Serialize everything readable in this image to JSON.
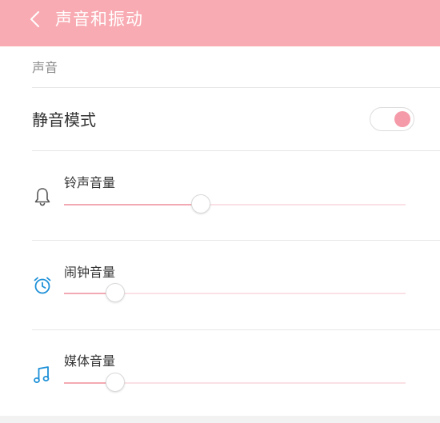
{
  "header": {
    "title": "声音和振动",
    "background": "#f8abb2",
    "back_icon": "chevron-left-icon"
  },
  "section": {
    "label": "声音"
  },
  "mute": {
    "label": "静音模式",
    "enabled": true,
    "accent": "#f59aa8"
  },
  "volumes": [
    {
      "label": "铃声音量",
      "icon": "bell-icon",
      "icon_color": "#555555",
      "level": 0.4
    },
    {
      "label": "闹钟音量",
      "icon": "alarm-clock-icon",
      "icon_color": "#1e90d8",
      "level": 0.15
    },
    {
      "label": "媒体音量",
      "icon": "music-note-icon",
      "icon_color": "#1e90d8",
      "level": 0.15
    }
  ]
}
